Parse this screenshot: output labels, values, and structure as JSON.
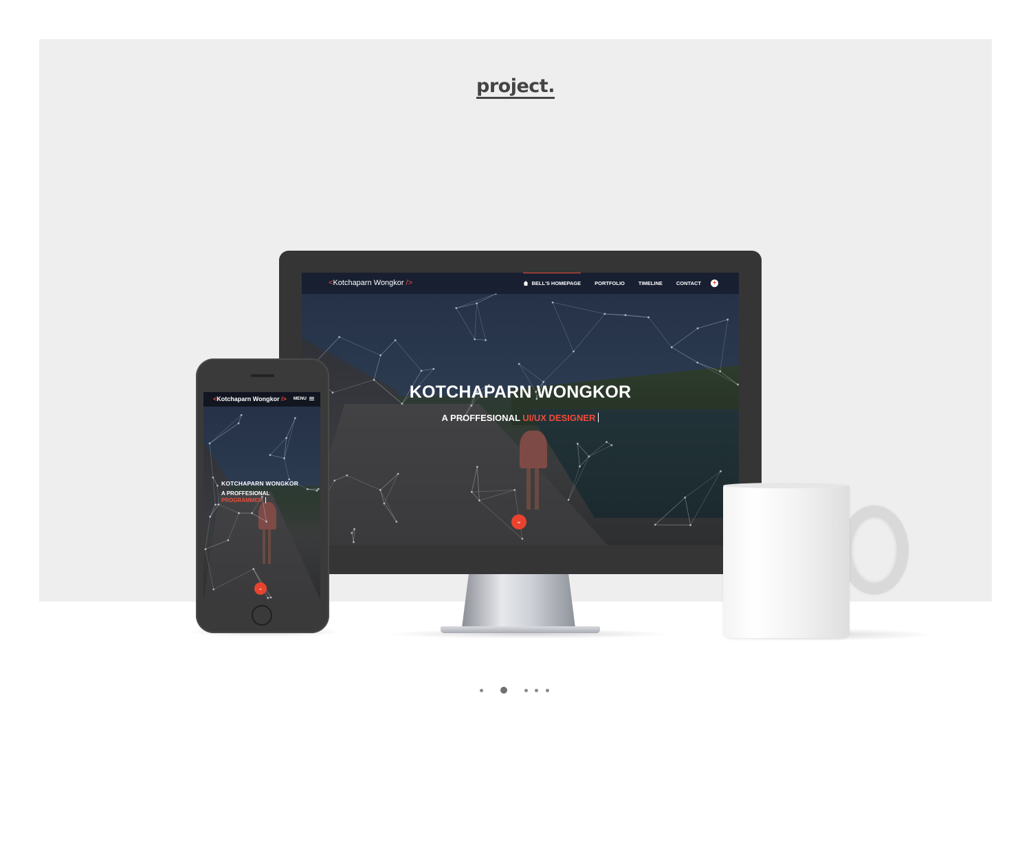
{
  "logo": {
    "text": "project."
  },
  "desktop_site": {
    "brand_open": "<",
    "brand_name": "Kotchaparn Wongkor",
    "brand_close": " />",
    "nav": [
      {
        "label": "BELL'S HOMEPAGE",
        "icon": "home-icon",
        "active": true
      },
      {
        "label": "PORTFOLIO",
        "active": false
      },
      {
        "label": "TIMELINE",
        "active": false
      },
      {
        "label": "CONTACT",
        "active": false
      }
    ],
    "nav_plus": "+",
    "hero_title": "KOTCHAPARN WONGKOR",
    "hero_sub_prefix": "A PROFFESIONAL ",
    "hero_sub_highlight": "UI/UX DESIGNER",
    "scroll_down": "⌄"
  },
  "mobile_site": {
    "brand_open": "<",
    "brand_name": "Kotchaparn Wongkor",
    "brand_close": " />",
    "menu_label": "MENU",
    "hero_title": "KOTCHAPARN WONGKOR",
    "hero_sub_prefix": "A PROFFESIONAL",
    "hero_sub_highlight": "PROGRAMMER",
    "scroll_down": "⌄"
  },
  "colors": {
    "accent": "#ef4b3a",
    "backdrop": "#eeeeee",
    "device": "#353535"
  },
  "pager": {
    "count": 5,
    "active_index": 1
  }
}
